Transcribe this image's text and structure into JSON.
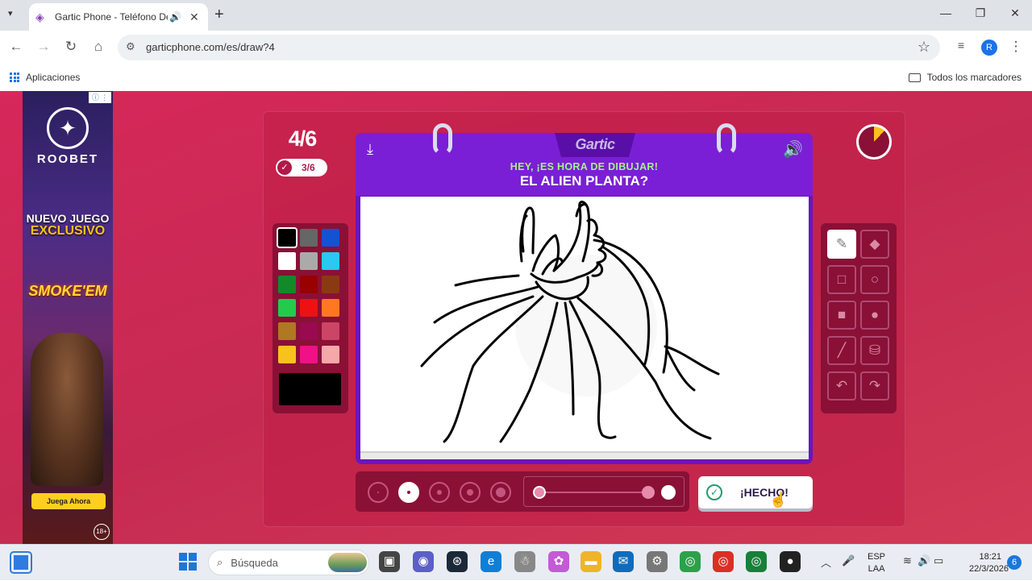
{
  "browser": {
    "tab_title": "Gartic Phone - Teléfono De",
    "url": "garticphone.com/es/draw?4",
    "bookmark_apps": "Aplicaciones",
    "bookmark_all": "Todos los marcadores",
    "profile_initial": "R"
  },
  "ad": {
    "brand": "ROOBET",
    "headline1": "NUEVO JUEGO",
    "headline2": "EXCLUSIVO",
    "game_name": "SMOKE'EM",
    "cta": "Juega Ahora",
    "age": "18+"
  },
  "game": {
    "round": "4/6",
    "players_done": "3/6",
    "logo": "Gartic",
    "prompt_small": "HEY, ¡ES HORA DE DIBUJAR!",
    "prompt_big": "EL ALIEN PLANTA?",
    "done_label": "¡HECHO!",
    "timer_elapsed_fraction": 0.12,
    "opacity_value": 1.0,
    "selected_brush_size_index": 1,
    "selected_tool": "pencil",
    "current_color": "#000000",
    "palette": [
      "#000000",
      "#666666",
      "#1452d2",
      "#ffffff",
      "#aaaaaa",
      "#2ac8f2",
      "#128a2a",
      "#990000",
      "#8a3a10",
      "#22cc4a",
      "#ee1111",
      "#ff7722",
      "#b07820",
      "#990a50",
      "#cc4466",
      "#f8c21c",
      "#ee1188",
      "#f6a7a7"
    ],
    "tools": [
      "pencil-icon",
      "eraser-icon",
      "rect-outline-icon",
      "circle-outline-icon",
      "rect-filled-icon",
      "circle-filled-icon",
      "line-icon",
      "fill-bucket-icon",
      "undo-icon",
      "redo-icon"
    ]
  },
  "taskbar": {
    "search_placeholder": "Búsqueda",
    "lang1": "ESP",
    "lang2": "LAA",
    "time": "18:21",
    "date": "22/3/2026",
    "notifications": "6"
  }
}
